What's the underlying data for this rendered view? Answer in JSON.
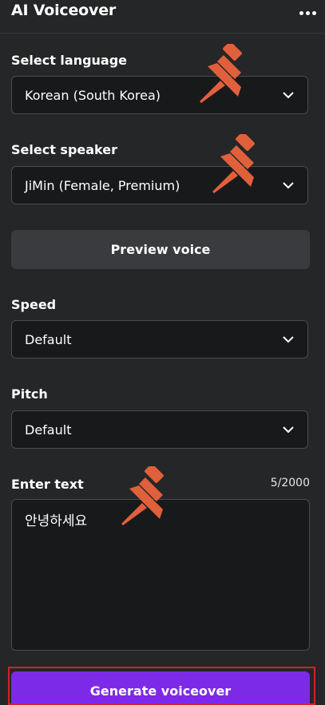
{
  "panel": {
    "title": "AI Voiceover",
    "more_icon": "more-horizontal-icon"
  },
  "language": {
    "label": "Select language",
    "value": "Korean (South Korea)"
  },
  "speaker": {
    "label": "Select speaker",
    "value": "JiMin (Female, Premium)"
  },
  "preview_button": "Preview voice",
  "speed": {
    "label": "Speed",
    "value": "Default"
  },
  "pitch": {
    "label": "Pitch",
    "value": "Default"
  },
  "text_input": {
    "label": "Enter text",
    "counter": "5/2000",
    "value": "안녕하세요"
  },
  "generate_button": "Generate voiceover",
  "colors": {
    "background": "#252627",
    "field": "#18191b",
    "accent": "#7d2ae8",
    "pin": "#e0603c",
    "highlight": "#d0212b"
  }
}
